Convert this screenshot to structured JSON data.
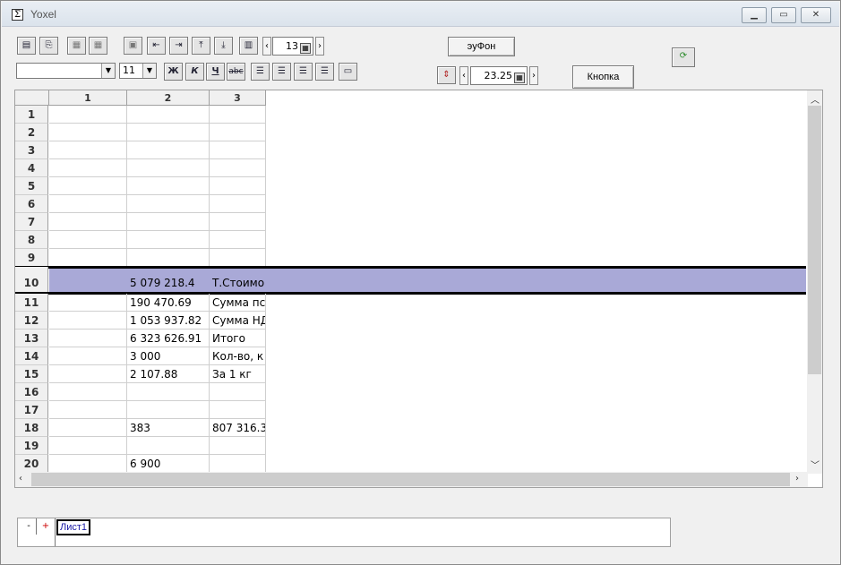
{
  "window": {
    "title": "Yoxel",
    "icon": "sigma-icon",
    "controls": [
      "minimize-icon",
      "maximize-icon",
      "close-icon"
    ]
  },
  "toolbar": {
    "font_size_value": "11",
    "page_spin_value": "13",
    "bold_label": "Ж",
    "italic_label": "К",
    "underline_label": "Ч",
    "strike_label": "abc",
    "eyfon_button": "эуФон",
    "row_height_value": "23.25",
    "knopka_button": "Кнопка"
  },
  "grid": {
    "columns": [
      "1",
      "2",
      "3"
    ],
    "rows": [
      {
        "n": "1",
        "c1": "",
        "c2": "",
        "c3": ""
      },
      {
        "n": "2",
        "c1": "",
        "c2": "",
        "c3": ""
      },
      {
        "n": "3",
        "c1": "",
        "c2": "",
        "c3": ""
      },
      {
        "n": "4",
        "c1": "",
        "c2": "",
        "c3": ""
      },
      {
        "n": "5",
        "c1": "",
        "c2": "",
        "c3": ""
      },
      {
        "n": "6",
        "c1": "",
        "c2": "",
        "c3": ""
      },
      {
        "n": "7",
        "c1": "",
        "c2": "",
        "c3": ""
      },
      {
        "n": "8",
        "c1": "",
        "c2": "",
        "c3": ""
      },
      {
        "n": "9",
        "c1": "",
        "c2": "",
        "c3": ""
      },
      {
        "n": "10",
        "c1": "",
        "c2": "5 079 218.4",
        "c3": "Т.Стоимо"
      },
      {
        "n": "11",
        "c1": "",
        "c2": "190 470.69",
        "c3": "Сумма пс"
      },
      {
        "n": "12",
        "c1": "",
        "c2": "1 053 937.82",
        "c3": "Сумма НД"
      },
      {
        "n": "13",
        "c1": "",
        "c2": "6 323 626.91",
        "c3": "Итого"
      },
      {
        "n": "14",
        "c1": "",
        "c2": "3 000",
        "c3": "Кол-во, к"
      },
      {
        "n": "15",
        "c1": "",
        "c2": "2 107.88",
        "c3": "За 1 кг"
      },
      {
        "n": "16",
        "c1": "",
        "c2": "",
        "c3": ""
      },
      {
        "n": "17",
        "c1": "",
        "c2": "",
        "c3": ""
      },
      {
        "n": "18",
        "c1": "",
        "c2": "383",
        "c3": "807 316.3"
      },
      {
        "n": "19",
        "c1": "",
        "c2": "",
        "c3": ""
      },
      {
        "n": "20",
        "c1": "",
        "c2": "6 900",
        "c3": ""
      }
    ]
  },
  "sheets": {
    "minus_label": "-",
    "plus_label": "+",
    "active": "Лист1"
  },
  "colors": {
    "selected_row": "#a9a9d7",
    "sheet_tab_text": "#1a1aa6"
  }
}
